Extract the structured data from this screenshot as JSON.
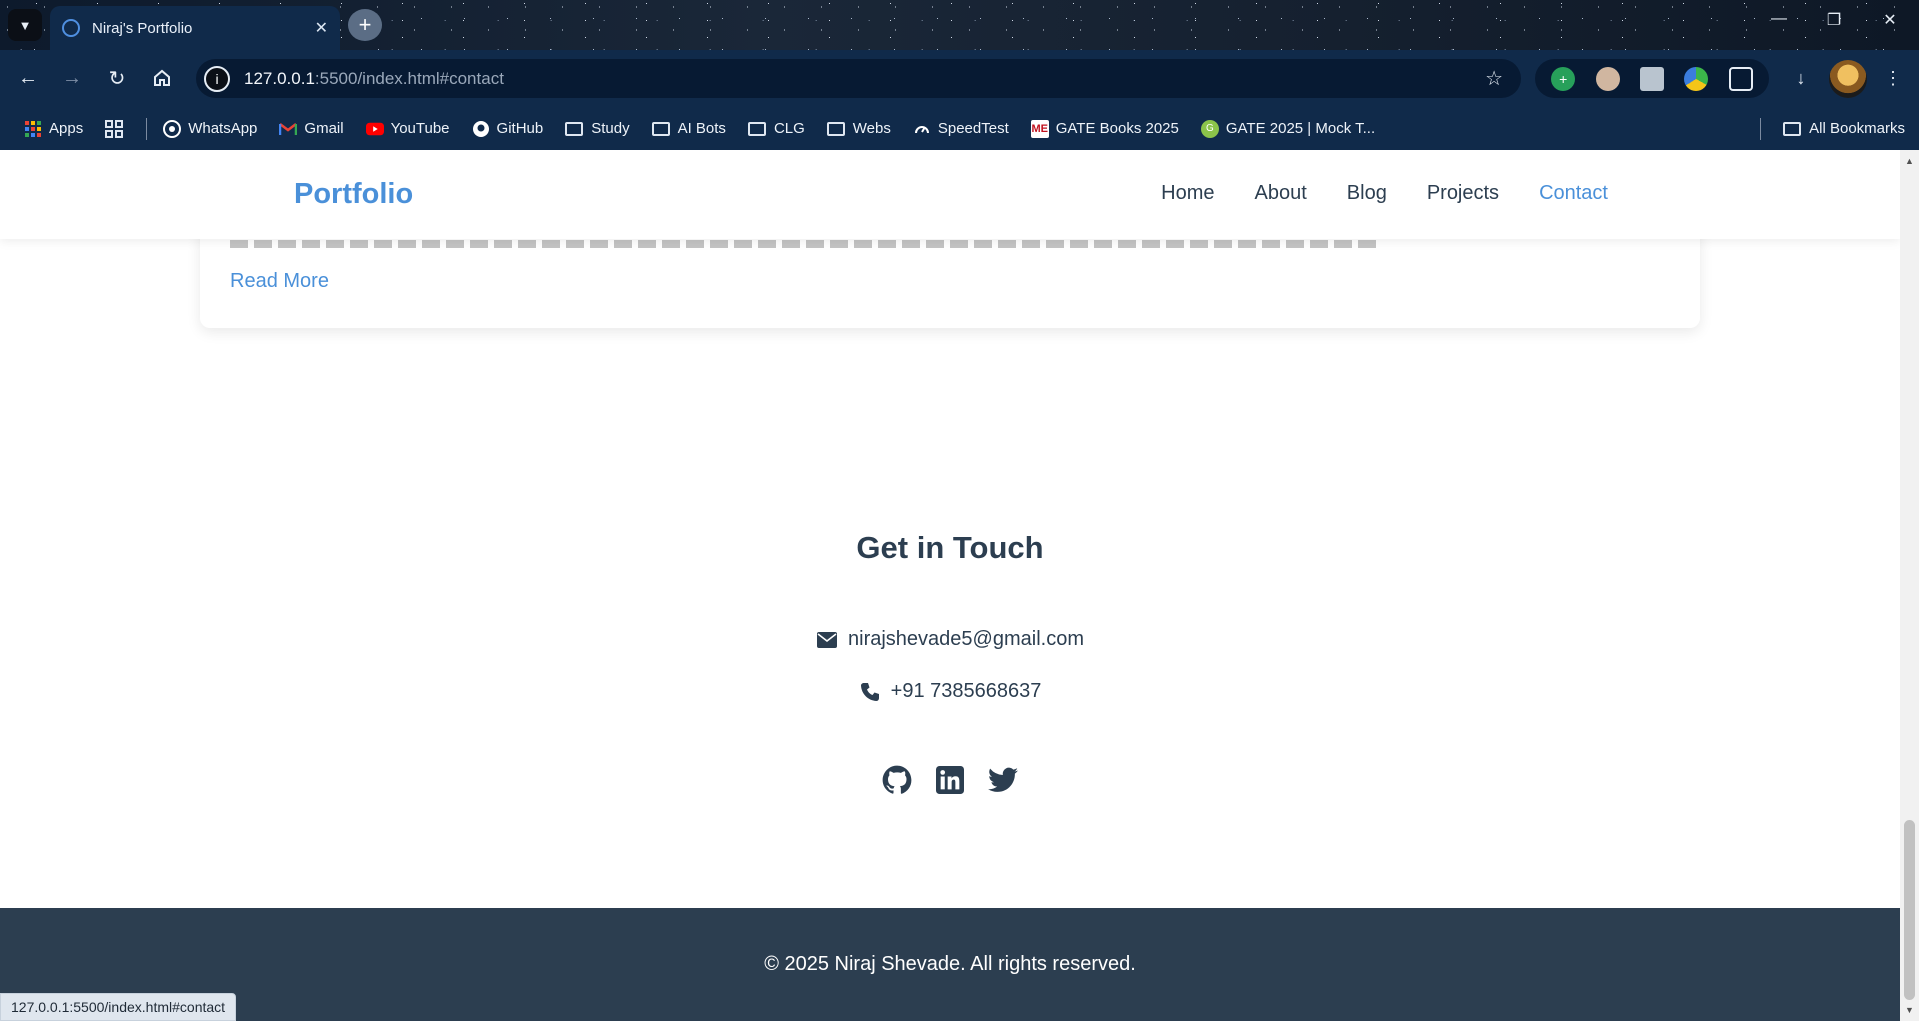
{
  "browser": {
    "tab_title": "Niraj's Portfolio",
    "url_host": "127.0.0.1",
    "url_rest": ":5500/index.html#contact",
    "bookmarks": [
      {
        "label": "Apps",
        "icon": "apps-grid-icon"
      },
      {
        "label": "WhatsApp",
        "icon": "whatsapp-icon"
      },
      {
        "label": "Gmail",
        "icon": "gmail-icon"
      },
      {
        "label": "YouTube",
        "icon": "youtube-icon"
      },
      {
        "label": "GitHub",
        "icon": "github-icon"
      },
      {
        "label": "Study",
        "icon": "folder-icon"
      },
      {
        "label": "AI Bots",
        "icon": "folder-icon"
      },
      {
        "label": "CLG",
        "icon": "folder-icon"
      },
      {
        "label": "Webs",
        "icon": "folder-icon"
      },
      {
        "label": "SpeedTest",
        "icon": "speedtest-icon"
      },
      {
        "label": "GATE Books 2025",
        "icon": "book-icon"
      },
      {
        "label": "GATE 2025 | Mock T...",
        "icon": "mock-test-icon"
      }
    ],
    "all_bookmarks": "All Bookmarks",
    "status_url": "127.0.0.1:5500/index.html#contact"
  },
  "site": {
    "logo": "Portfolio",
    "nav": [
      "Home",
      "About",
      "Blog",
      "Projects",
      "Contact"
    ],
    "active_nav": "Contact",
    "read_more": "Read More",
    "contact_title": "Get in Touch",
    "email": "nirajshevade5@gmail.com",
    "phone": "+91 7385668637",
    "socials": [
      "github-icon",
      "linkedin-icon",
      "twitter-icon"
    ],
    "footer": "© 2025 Niraj Shevade. All rights reserved."
  },
  "colors": {
    "accent": "#4a90d9",
    "text": "#2c3e50",
    "footer_bg": "#2c3e50",
    "chrome_bg": "#102a4a"
  }
}
